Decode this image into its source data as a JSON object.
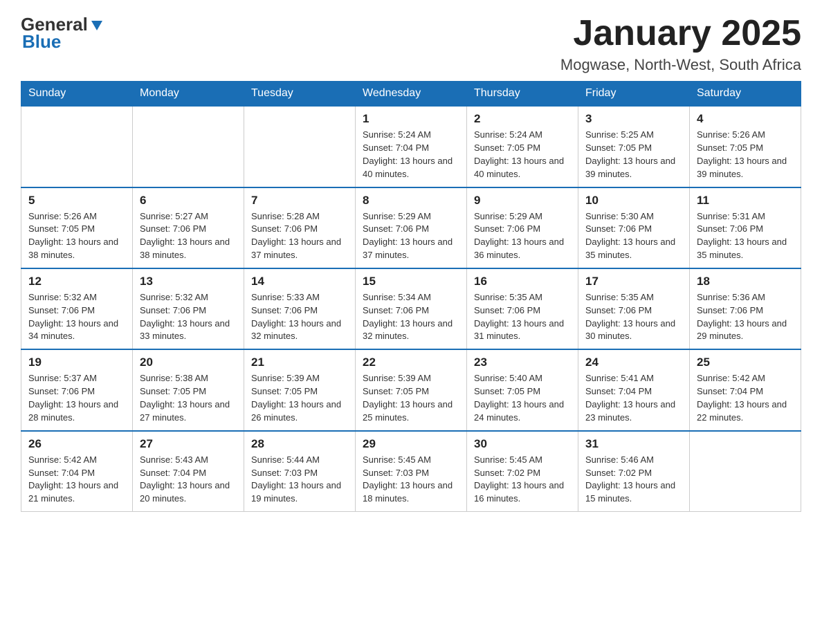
{
  "header": {
    "logo_general": "General",
    "logo_blue": "Blue",
    "title": "January 2025",
    "location": "Mogwase, North-West, South Africa"
  },
  "weekdays": [
    "Sunday",
    "Monday",
    "Tuesday",
    "Wednesday",
    "Thursday",
    "Friday",
    "Saturday"
  ],
  "weeks": [
    [
      {
        "day": "",
        "info": ""
      },
      {
        "day": "",
        "info": ""
      },
      {
        "day": "",
        "info": ""
      },
      {
        "day": "1",
        "info": "Sunrise: 5:24 AM\nSunset: 7:04 PM\nDaylight: 13 hours and 40 minutes."
      },
      {
        "day": "2",
        "info": "Sunrise: 5:24 AM\nSunset: 7:05 PM\nDaylight: 13 hours and 40 minutes."
      },
      {
        "day": "3",
        "info": "Sunrise: 5:25 AM\nSunset: 7:05 PM\nDaylight: 13 hours and 39 minutes."
      },
      {
        "day": "4",
        "info": "Sunrise: 5:26 AM\nSunset: 7:05 PM\nDaylight: 13 hours and 39 minutes."
      }
    ],
    [
      {
        "day": "5",
        "info": "Sunrise: 5:26 AM\nSunset: 7:05 PM\nDaylight: 13 hours and 38 minutes."
      },
      {
        "day": "6",
        "info": "Sunrise: 5:27 AM\nSunset: 7:06 PM\nDaylight: 13 hours and 38 minutes."
      },
      {
        "day": "7",
        "info": "Sunrise: 5:28 AM\nSunset: 7:06 PM\nDaylight: 13 hours and 37 minutes."
      },
      {
        "day": "8",
        "info": "Sunrise: 5:29 AM\nSunset: 7:06 PM\nDaylight: 13 hours and 37 minutes."
      },
      {
        "day": "9",
        "info": "Sunrise: 5:29 AM\nSunset: 7:06 PM\nDaylight: 13 hours and 36 minutes."
      },
      {
        "day": "10",
        "info": "Sunrise: 5:30 AM\nSunset: 7:06 PM\nDaylight: 13 hours and 35 minutes."
      },
      {
        "day": "11",
        "info": "Sunrise: 5:31 AM\nSunset: 7:06 PM\nDaylight: 13 hours and 35 minutes."
      }
    ],
    [
      {
        "day": "12",
        "info": "Sunrise: 5:32 AM\nSunset: 7:06 PM\nDaylight: 13 hours and 34 minutes."
      },
      {
        "day": "13",
        "info": "Sunrise: 5:32 AM\nSunset: 7:06 PM\nDaylight: 13 hours and 33 minutes."
      },
      {
        "day": "14",
        "info": "Sunrise: 5:33 AM\nSunset: 7:06 PM\nDaylight: 13 hours and 32 minutes."
      },
      {
        "day": "15",
        "info": "Sunrise: 5:34 AM\nSunset: 7:06 PM\nDaylight: 13 hours and 32 minutes."
      },
      {
        "day": "16",
        "info": "Sunrise: 5:35 AM\nSunset: 7:06 PM\nDaylight: 13 hours and 31 minutes."
      },
      {
        "day": "17",
        "info": "Sunrise: 5:35 AM\nSunset: 7:06 PM\nDaylight: 13 hours and 30 minutes."
      },
      {
        "day": "18",
        "info": "Sunrise: 5:36 AM\nSunset: 7:06 PM\nDaylight: 13 hours and 29 minutes."
      }
    ],
    [
      {
        "day": "19",
        "info": "Sunrise: 5:37 AM\nSunset: 7:06 PM\nDaylight: 13 hours and 28 minutes."
      },
      {
        "day": "20",
        "info": "Sunrise: 5:38 AM\nSunset: 7:05 PM\nDaylight: 13 hours and 27 minutes."
      },
      {
        "day": "21",
        "info": "Sunrise: 5:39 AM\nSunset: 7:05 PM\nDaylight: 13 hours and 26 minutes."
      },
      {
        "day": "22",
        "info": "Sunrise: 5:39 AM\nSunset: 7:05 PM\nDaylight: 13 hours and 25 minutes."
      },
      {
        "day": "23",
        "info": "Sunrise: 5:40 AM\nSunset: 7:05 PM\nDaylight: 13 hours and 24 minutes."
      },
      {
        "day": "24",
        "info": "Sunrise: 5:41 AM\nSunset: 7:04 PM\nDaylight: 13 hours and 23 minutes."
      },
      {
        "day": "25",
        "info": "Sunrise: 5:42 AM\nSunset: 7:04 PM\nDaylight: 13 hours and 22 minutes."
      }
    ],
    [
      {
        "day": "26",
        "info": "Sunrise: 5:42 AM\nSunset: 7:04 PM\nDaylight: 13 hours and 21 minutes."
      },
      {
        "day": "27",
        "info": "Sunrise: 5:43 AM\nSunset: 7:04 PM\nDaylight: 13 hours and 20 minutes."
      },
      {
        "day": "28",
        "info": "Sunrise: 5:44 AM\nSunset: 7:03 PM\nDaylight: 13 hours and 19 minutes."
      },
      {
        "day": "29",
        "info": "Sunrise: 5:45 AM\nSunset: 7:03 PM\nDaylight: 13 hours and 18 minutes."
      },
      {
        "day": "30",
        "info": "Sunrise: 5:45 AM\nSunset: 7:02 PM\nDaylight: 13 hours and 16 minutes."
      },
      {
        "day": "31",
        "info": "Sunrise: 5:46 AM\nSunset: 7:02 PM\nDaylight: 13 hours and 15 minutes."
      },
      {
        "day": "",
        "info": ""
      }
    ]
  ]
}
